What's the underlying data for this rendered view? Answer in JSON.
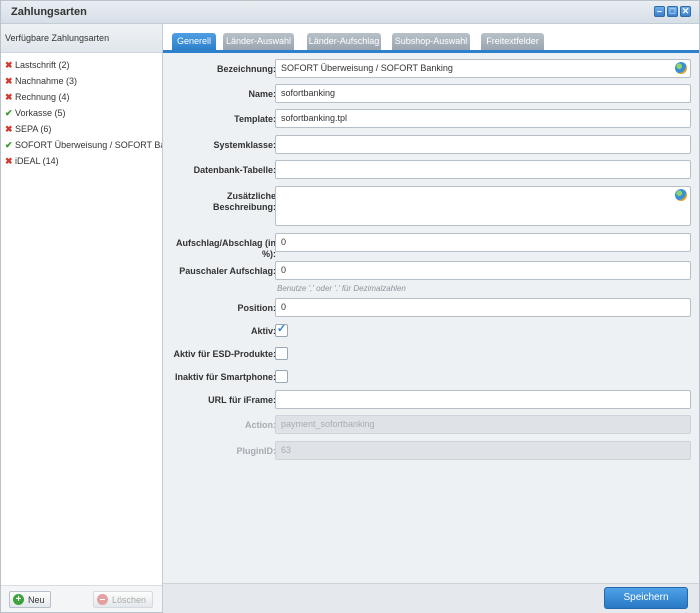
{
  "window": {
    "title": "Zahlungsarten"
  },
  "sidebar": {
    "header": "Verfügbare Zahlungsarten",
    "items": [
      {
        "label": "Lastschrift (2)",
        "status": "inactive"
      },
      {
        "label": "Nachnahme (3)",
        "status": "inactive"
      },
      {
        "label": "Rechnung (4)",
        "status": "inactive"
      },
      {
        "label": "Vorkasse (5)",
        "status": "active"
      },
      {
        "label": "SEPA (6)",
        "status": "inactive"
      },
      {
        "label": "SOFORT Überweisung / SOFORT Banking",
        "status": "active"
      },
      {
        "label": "iDEAL (14)",
        "status": "inactive"
      }
    ],
    "new_button": "Neu",
    "delete_button": "Löschen"
  },
  "tabs": [
    "Generell",
    "Länder-Auswahl",
    "Länder-Aufschlag",
    "Subshop-Auswahl",
    "Freitextfelder"
  ],
  "form": {
    "bezeichnung": {
      "label": "Bezeichnung:",
      "value": "SOFORT Überweisung / SOFORT Banking"
    },
    "name": {
      "label": "Name:",
      "value": "sofortbanking"
    },
    "template": {
      "label": "Template:",
      "value": "sofortbanking.tpl"
    },
    "systemklasse": {
      "label": "Systemklasse:",
      "value": ""
    },
    "tabelle": {
      "label": "Datenbank-Tabelle:",
      "value": ""
    },
    "beschreibung": {
      "label_line1": "Zusätzliche",
      "label_line2": "Beschreibung:",
      "value": ""
    },
    "aufschlag": {
      "label_line1": "Aufschlag/Abschlag (in",
      "label_line2": "%):",
      "value": "0"
    },
    "pauschal": {
      "label": "Pauschaler Aufschlag:",
      "value": "0",
      "hint": "Benutze ',' oder '.' für Dezimalzahlen"
    },
    "position": {
      "label": "Position:",
      "value": "0"
    },
    "aktiv": {
      "label": "Aktiv:",
      "checked": true
    },
    "esd": {
      "label": "Aktiv für ESD-Produkte:",
      "checked": false
    },
    "smartphone": {
      "label": "Inaktiv für Smartphone:",
      "checked": false
    },
    "iframe": {
      "label": "URL für iFrame:",
      "value": ""
    },
    "action": {
      "label": "Action:",
      "value": "payment_sofortbanking"
    },
    "pluginid": {
      "label": "PluginID:",
      "value": "63"
    }
  },
  "save_button": "Speichern",
  "colors": {
    "accent": "#2d80cb",
    "inactive": "#d13b2f",
    "active": "#3a9a2a"
  }
}
